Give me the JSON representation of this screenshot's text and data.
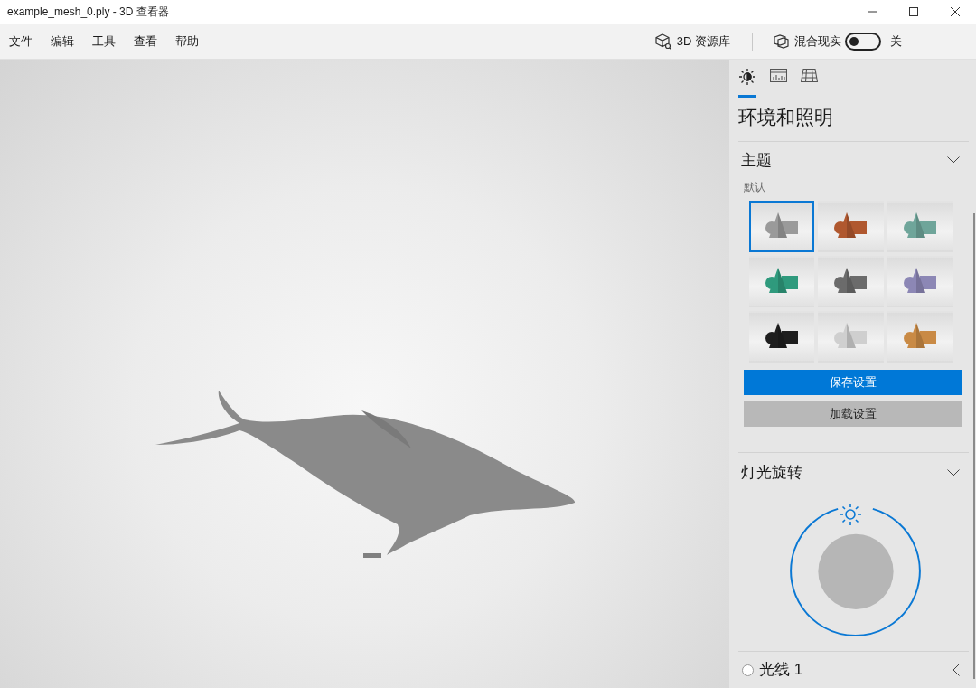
{
  "window": {
    "title": "example_mesh_0.ply - 3D 查看器"
  },
  "menu": [
    "文件",
    "编辑",
    "工具",
    "查看",
    "帮助"
  ],
  "toolbar": {
    "library": "3D 资源库",
    "mixed_reality": {
      "label": "混合现实",
      "on": false,
      "state_text": "关"
    }
  },
  "panel": {
    "tabs": [
      {
        "kind": "lighting",
        "selected": true
      },
      {
        "kind": "stats",
        "selected": false
      },
      {
        "kind": "grid",
        "selected": false
      }
    ],
    "heading": "环境和照明",
    "theme": {
      "title": "主题",
      "expanded": true,
      "caption": "默认",
      "swatches": [
        {
          "color": "#9a9a9a",
          "selected": true
        },
        {
          "color": "#b0582f",
          "selected": false
        },
        {
          "color": "#6fa59a",
          "selected": false
        },
        {
          "color": "#2f9a7d",
          "selected": false
        },
        {
          "color": "#6b6b6b",
          "selected": false
        },
        {
          "color": "#8c87b5",
          "selected": false
        },
        {
          "color": "#1e1e1e",
          "selected": false
        },
        {
          "color": "#cfcfcf",
          "selected": false
        },
        {
          "color": "#c98a45",
          "selected": false
        }
      ],
      "buttons": [
        {
          "label": "保存设置",
          "kind": "primary"
        },
        {
          "label": "加载设置",
          "kind": "secondary"
        }
      ]
    },
    "rotation": {
      "title": "灯光旋转",
      "expanded": true
    },
    "light": {
      "label": "光线 1",
      "selected": false,
      "expanded": false
    }
  }
}
